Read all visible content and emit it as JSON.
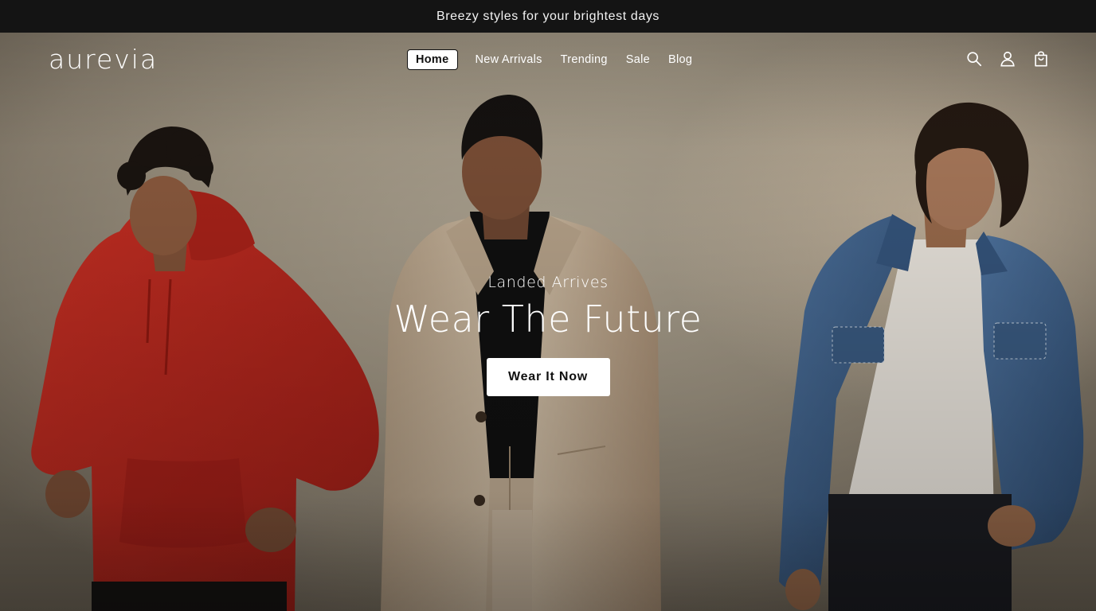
{
  "announcement": {
    "text": "Breezy styles for your brightest days"
  },
  "header": {
    "logo": "aurevia",
    "nav": [
      {
        "label": "Home",
        "active": true
      },
      {
        "label": "New Arrivals",
        "active": false
      },
      {
        "label": "Trending",
        "active": false
      },
      {
        "label": "Sale",
        "active": false
      },
      {
        "label": "Blog",
        "active": false
      }
    ],
    "icons": [
      "search-icon",
      "account-icon",
      "cart-icon"
    ]
  },
  "hero": {
    "kicker": "Landed Arrives",
    "headline": "Wear The Future",
    "cta_label": "Wear It Now"
  },
  "colors": {
    "announcement_bg": "#141414",
    "hero_backdrop": "#a39a88",
    "hoodie": "#b7261d",
    "trench": "#c6b39b",
    "denim": "#3d5f87"
  }
}
